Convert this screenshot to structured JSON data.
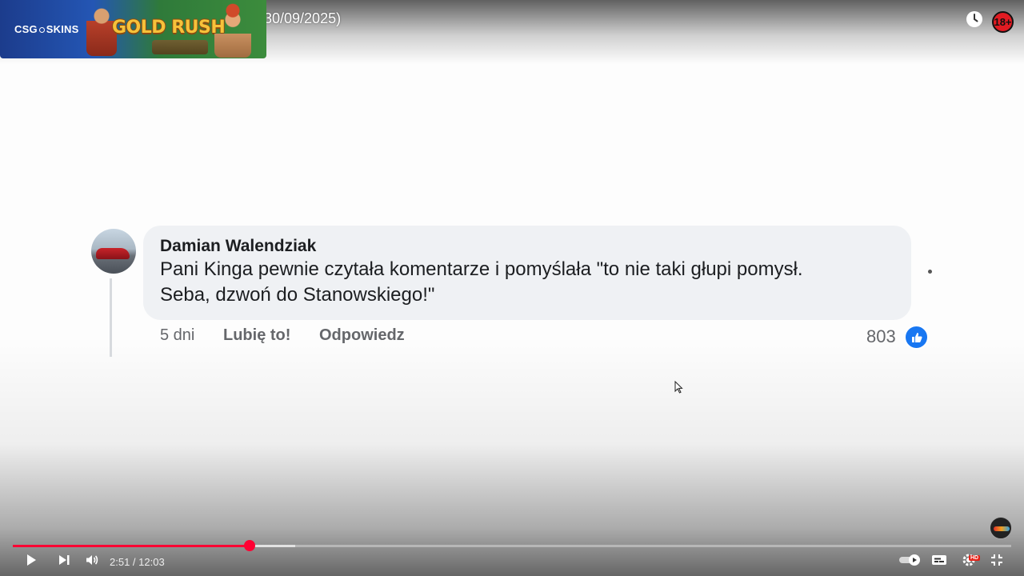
{
  "player": {
    "title_visible": "30/09/2025)",
    "current_time": "2:51",
    "duration": "12:03",
    "time_display": "2:51 / 12:03",
    "played_fraction": 0.237,
    "buffered_fraction": 0.283,
    "accent_color": "#ff0033",
    "age_badge": "18+",
    "hd_badge": "HD"
  },
  "banner": {
    "brand": "CSG",
    "brand_suffix": "SKINS",
    "game_title": "GOLD RUSH"
  },
  "comment": {
    "author": "Damian Walendziak",
    "text_line1": "Pani Kinga pewnie czytała komentarze i pomyślała \"to nie taki głupi pomysł.",
    "text_line2": "Seba, dzwoń do Stanowskiego!\"",
    "time": "5 dni",
    "like_action": "Lubię to!",
    "reply_action": "Odpowiedz",
    "like_count": "803"
  },
  "icons": {
    "clock": "clock-icon",
    "play": "play-icon",
    "next": "next-icon",
    "volume": "volume-icon",
    "autoplay": "autoplay-toggle-icon",
    "subtitles": "subtitles-icon",
    "settings": "settings-icon",
    "exit_fullscreen": "exit-fullscreen-icon",
    "like": "thumbs-up-icon"
  }
}
